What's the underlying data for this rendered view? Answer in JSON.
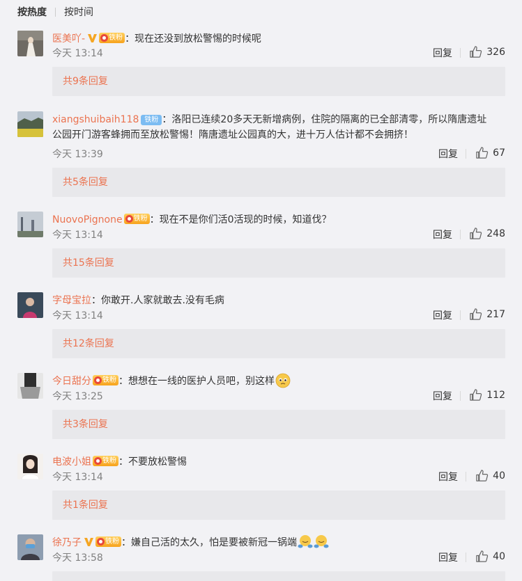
{
  "sort": {
    "hot_label": "按热度",
    "time_label": "按时间"
  },
  "comments": [
    {
      "username": "医美吖-",
      "has_v": true,
      "has_fan": true,
      "fan_label": "铁粉",
      "has_tie": false,
      "text": "：现在还没到放松警惕的时候呢",
      "text2": "",
      "time": "今天 13:14",
      "reply_label": "回复",
      "likes": "326",
      "more": "共9条回复"
    },
    {
      "username": "xiangshuibaih118",
      "has_v": false,
      "has_fan": false,
      "has_tie": true,
      "fan_label": "铁粉",
      "text": "：洛阳已连续20多天无新增病例，住院的隔离的已全部清零，所以隋唐遗址",
      "text2": "公园开门游客蜂拥而至放松警惕！隋唐遗址公园真的大，进十万人估计都不会拥挤！",
      "time": "今天 13:39",
      "reply_label": "回复",
      "likes": "67",
      "more": "共5条回复"
    },
    {
      "username": "NuovoPignone",
      "has_v": false,
      "has_fan": true,
      "fan_label": "铁粉",
      "has_tie": false,
      "text": "：现在不是你们活0活现的时候，知道伐？",
      "text2": "",
      "time": "今天 13:14",
      "reply_label": "回复",
      "likes": "248",
      "more": "共15条回复"
    },
    {
      "username": "字母宝拉",
      "has_v": false,
      "has_fan": false,
      "has_tie": false,
      "fan_label": "",
      "text": "：你敢开.人家就敢去.没有毛病",
      "text2": "",
      "time": "今天 13:14",
      "reply_label": "回复",
      "likes": "217",
      "more": "共12条回复"
    },
    {
      "username": "今日甜分",
      "has_v": false,
      "has_fan": true,
      "fan_label": "铁粉",
      "has_tie": false,
      "text": "：想想在一线的医护人员吧，别这样",
      "text2": "",
      "time": "今天 13:25",
      "reply_label": "回复",
      "likes": "112",
      "more": "共3条回复",
      "emoji": "pleading-face"
    },
    {
      "username": "电波小姐",
      "has_v": false,
      "has_fan": true,
      "fan_label": "铁粉",
      "has_tie": false,
      "text": "：不要放松警惕",
      "text2": "",
      "time": "今天 13:14",
      "reply_label": "回复",
      "likes": "40",
      "more": "共1条回复"
    },
    {
      "username": "徐乃子",
      "has_v": true,
      "has_fan": true,
      "fan_label": "铁粉",
      "has_tie": false,
      "text": "：嫌自己活的太久，怕是要被新冠一锅端",
      "text2": "",
      "time": "今天 13:58",
      "reply_label": "回复",
      "likes": "40",
      "more": "",
      "emoji": "hugging-face-x2"
    }
  ],
  "colors": {
    "username": "#eb7350",
    "time": "#808080",
    "more_bg": "#e8e8eb",
    "page_bg": "#f2f2f5"
  }
}
